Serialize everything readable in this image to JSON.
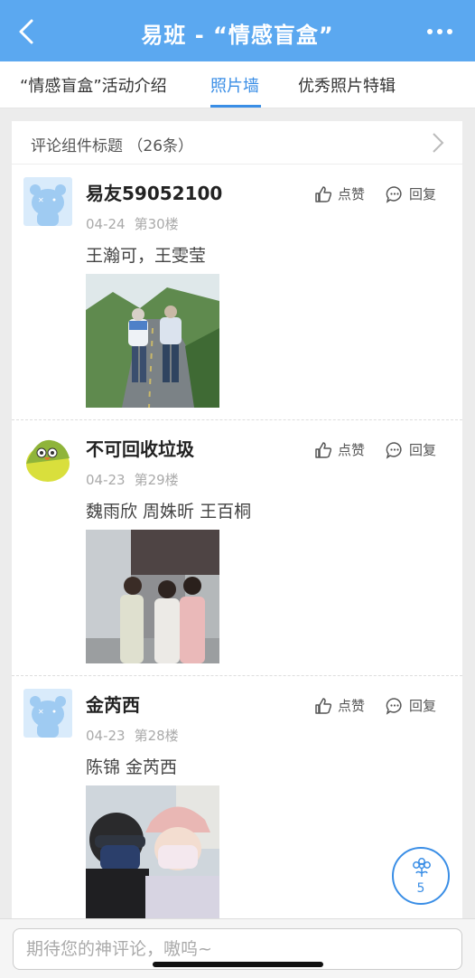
{
  "header": {
    "title": "易班 - “情感盲盒”",
    "back_icon": "chevron-left-icon",
    "more_icon": "more-dots-icon",
    "color": "#5ba8f0"
  },
  "tabs": [
    {
      "label": "“情感盲盒”活动介绍",
      "active": false
    },
    {
      "label": "照片墙",
      "active": true
    },
    {
      "label": "优秀照片特辑",
      "active": false
    }
  ],
  "accent": "#3a8ee6",
  "comments_panel": {
    "title": "评论组件标题  （26条）"
  },
  "comments": [
    {
      "user": "易友59052100",
      "date": "04-24",
      "floor": "第30楼",
      "text": "王瀚可，王雯莹",
      "avatar": "bear-avatar",
      "like_label": "点赞",
      "reply_label": "回复"
    },
    {
      "user": "不可回收垃圾",
      "date": "04-23",
      "floor": "第29楼",
      "text": "魏雨欣 周姝昕 王百桐",
      "avatar": "bird-avatar",
      "like_label": "点赞",
      "reply_label": "回复"
    },
    {
      "user": "金芮西",
      "date": "04-23",
      "floor": "第28楼",
      "text": "陈锦 金芮西",
      "avatar": "bear-avatar",
      "like_label": "点赞",
      "reply_label": "回复"
    }
  ],
  "floating_button": {
    "icon": "flower-icon",
    "count": "5"
  },
  "input": {
    "placeholder": "期待您的神评论，嗷呜~"
  }
}
